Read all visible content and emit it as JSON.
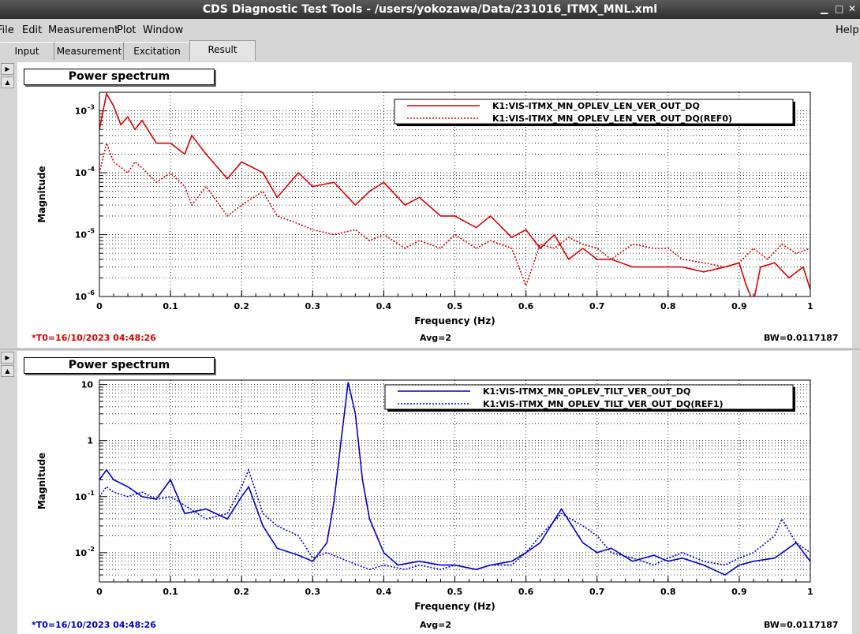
{
  "window": {
    "title": "CDS Diagnostic Test Tools - /users/yokozawa/Data/231016_ITMX_MNL.xml"
  },
  "menu": {
    "file": "File",
    "edit": "Edit",
    "measurement": "Measurement",
    "plot": "Plot",
    "window": "Window",
    "help": "Help"
  },
  "tabs": [
    "Input",
    "Measurement",
    "Excitation",
    "Result"
  ],
  "panels": [
    {
      "title": "Power spectrum",
      "t0": "*T0=16/10/2023 04:48:26",
      "avg": "Avg=2",
      "bw": "BW=0.0117187"
    },
    {
      "title": "Power spectrum",
      "t0": "*T0=16/10/2023 04:48:26",
      "avg": "Avg=2",
      "bw": "BW=0.0117187"
    }
  ],
  "chart_data": [
    {
      "type": "line",
      "title": "",
      "xlabel": "Frequency (Hz)",
      "ylabel": "Magnitude",
      "xlim": [
        0,
        1
      ],
      "ylim": [
        1e-06,
        0.002
      ],
      "yscale": "log",
      "grid": true,
      "legend": "top-right",
      "xticks": [
        "0",
        "0.1",
        "0.2",
        "0.3",
        "0.4",
        "0.5",
        "0.6",
        "0.7",
        "0.8",
        "0.9",
        "1"
      ],
      "ytick_values": [
        1e-06,
        1e-05,
        0.0001,
        0.001
      ],
      "yticks": [
        "10^-6",
        "10^-5",
        "10^-4",
        "10^-3"
      ],
      "series": [
        {
          "name": "K1:VIS-ITMX_MN_OPLEV_LEN_VER_OUT_DQ",
          "color": "#dd0000",
          "style": "solid",
          "x": [
            0,
            0.01,
            0.02,
            0.03,
            0.04,
            0.05,
            0.06,
            0.08,
            0.1,
            0.12,
            0.13,
            0.15,
            0.18,
            0.2,
            0.23,
            0.25,
            0.28,
            0.3,
            0.33,
            0.36,
            0.38,
            0.4,
            0.43,
            0.45,
            0.48,
            0.5,
            0.53,
            0.55,
            0.58,
            0.6,
            0.62,
            0.64,
            0.66,
            0.68,
            0.7,
            0.72,
            0.75,
            0.78,
            0.8,
            0.82,
            0.85,
            0.88,
            0.9,
            0.91,
            0.92,
            0.93,
            0.95,
            0.97,
            0.99,
            1
          ],
          "y": [
            0.0005,
            0.0019,
            0.0012,
            0.0006,
            0.0008,
            0.0005,
            0.0007,
            0.0003,
            0.0003,
            0.0002,
            0.0004,
            0.0002,
            8e-05,
            0.00015,
            0.0001,
            4e-05,
            0.0001,
            6e-05,
            7e-05,
            3e-05,
            5e-05,
            7e-05,
            3e-05,
            4e-05,
            2e-05,
            2e-05,
            1.3e-05,
            2e-05,
            9e-06,
            1.2e-05,
            6e-06,
            1e-05,
            4e-06,
            6e-06,
            4e-06,
            4e-06,
            3e-06,
            3e-06,
            3e-06,
            3e-06,
            2.5e-06,
            3e-06,
            3.5e-06,
            1.5e-06,
            8e-07,
            3e-06,
            3.5e-06,
            2e-06,
            3e-06,
            1.3e-06
          ]
        },
        {
          "name": "K1:VIS-ITMX_MN_OPLEV_LEN_VER_OUT_DQ(REF0)",
          "color": "#dd0000",
          "style": "dotted",
          "x": [
            0,
            0.01,
            0.02,
            0.04,
            0.05,
            0.06,
            0.08,
            0.1,
            0.12,
            0.13,
            0.15,
            0.18,
            0.2,
            0.23,
            0.25,
            0.28,
            0.3,
            0.33,
            0.36,
            0.38,
            0.4,
            0.43,
            0.45,
            0.48,
            0.5,
            0.53,
            0.55,
            0.58,
            0.6,
            0.62,
            0.64,
            0.66,
            0.68,
            0.7,
            0.72,
            0.75,
            0.78,
            0.8,
            0.82,
            0.85,
            0.88,
            0.9,
            0.92,
            0.94,
            0.96,
            0.98,
            1
          ],
          "y": [
            0.0001,
            0.0003,
            0.00015,
            0.0001,
            0.00015,
            0.00012,
            7e-05,
            0.0001,
            6e-05,
            3e-05,
            6e-05,
            2e-05,
            3e-05,
            5e-05,
            2e-05,
            1.5e-05,
            1.2e-05,
            1e-05,
            1.2e-05,
            8e-06,
            1e-05,
            6e-06,
            8e-06,
            6e-06,
            1e-05,
            6e-06,
            8e-06,
            6e-06,
            1.5e-06,
            7e-06,
            6e-06,
            9e-06,
            7e-06,
            6e-06,
            4e-06,
            7e-06,
            6e-06,
            6e-06,
            4e-06,
            3.5e-06,
            3e-06,
            3.5e-06,
            6e-06,
            4e-06,
            7e-06,
            5e-06,
            6e-06
          ]
        }
      ]
    },
    {
      "type": "line",
      "title": "",
      "xlabel": "Frequency (Hz)",
      "ylabel": "Magnitude",
      "xlim": [
        0,
        1
      ],
      "ylim": [
        0.003,
        12
      ],
      "yscale": "log",
      "grid": true,
      "legend": "top-right",
      "xticks": [
        "0",
        "0.1",
        "0.2",
        "0.3",
        "0.4",
        "0.5",
        "0.6",
        "0.7",
        "0.8",
        "0.9",
        "1"
      ],
      "ytick_values": [
        0.01,
        0.1,
        1,
        10
      ],
      "yticks": [
        "10^-2",
        "10^-1",
        "1",
        "10"
      ],
      "series": [
        {
          "name": "K1:VIS-ITMX_MN_OPLEV_TILT_VER_OUT_DQ",
          "color": "#0000cc",
          "style": "solid",
          "x": [
            0,
            0.01,
            0.02,
            0.04,
            0.06,
            0.08,
            0.1,
            0.12,
            0.15,
            0.18,
            0.2,
            0.21,
            0.23,
            0.25,
            0.28,
            0.3,
            0.32,
            0.33,
            0.34,
            0.35,
            0.36,
            0.37,
            0.38,
            0.4,
            0.42,
            0.45,
            0.48,
            0.5,
            0.53,
            0.55,
            0.58,
            0.6,
            0.62,
            0.65,
            0.68,
            0.7,
            0.72,
            0.75,
            0.78,
            0.8,
            0.82,
            0.85,
            0.88,
            0.9,
            0.92,
            0.95,
            0.98,
            1
          ],
          "y": [
            0.2,
            0.3,
            0.2,
            0.15,
            0.1,
            0.09,
            0.2,
            0.05,
            0.06,
            0.04,
            0.1,
            0.15,
            0.03,
            0.012,
            0.009,
            0.007,
            0.015,
            0.08,
            1,
            11,
            3,
            0.2,
            0.04,
            0.01,
            0.006,
            0.007,
            0.006,
            0.006,
            0.005,
            0.006,
            0.007,
            0.01,
            0.015,
            0.06,
            0.015,
            0.01,
            0.012,
            0.007,
            0.009,
            0.007,
            0.008,
            0.006,
            0.004,
            0.006,
            0.007,
            0.008,
            0.015,
            0.007
          ]
        },
        {
          "name": "K1:VIS-ITMX_MN_OPLEV_TILT_VER_OUT_DQ(REF1)",
          "color": "#0000cc",
          "style": "dotted",
          "x": [
            0,
            0.01,
            0.02,
            0.04,
            0.06,
            0.08,
            0.1,
            0.12,
            0.15,
            0.18,
            0.2,
            0.21,
            0.23,
            0.25,
            0.28,
            0.3,
            0.32,
            0.35,
            0.38,
            0.4,
            0.43,
            0.45,
            0.48,
            0.5,
            0.53,
            0.55,
            0.58,
            0.6,
            0.62,
            0.65,
            0.68,
            0.7,
            0.72,
            0.75,
            0.78,
            0.8,
            0.82,
            0.85,
            0.88,
            0.9,
            0.92,
            0.95,
            0.96,
            0.98,
            1
          ],
          "y": [
            0.1,
            0.15,
            0.12,
            0.1,
            0.12,
            0.09,
            0.1,
            0.07,
            0.04,
            0.05,
            0.15,
            0.3,
            0.05,
            0.03,
            0.02,
            0.008,
            0.01,
            0.007,
            0.005,
            0.006,
            0.005,
            0.006,
            0.005,
            0.006,
            0.005,
            0.006,
            0.006,
            0.01,
            0.02,
            0.05,
            0.03,
            0.02,
            0.01,
            0.008,
            0.006,
            0.008,
            0.01,
            0.007,
            0.006,
            0.008,
            0.01,
            0.02,
            0.04,
            0.015,
            0.01
          ]
        }
      ]
    }
  ]
}
